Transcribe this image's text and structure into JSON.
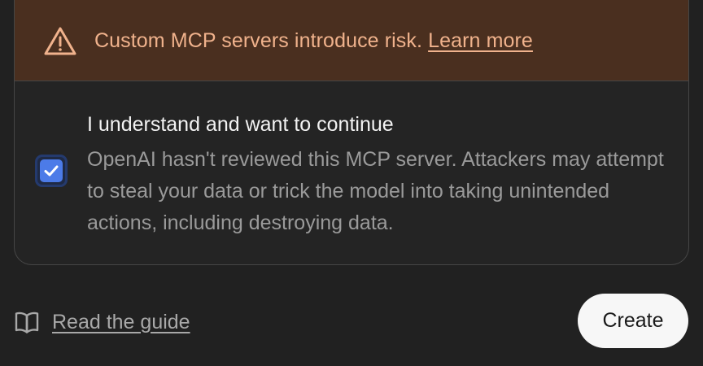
{
  "warning": {
    "icon": "warning-triangle-icon",
    "message": "Custom MCP servers introduce risk. ",
    "link_label": "Learn more",
    "color": "#f0b28c",
    "background": "#4a2f1f"
  },
  "consent": {
    "checked": true,
    "checkbox_icon": "checkmark-icon",
    "accent_color": "#4c7be8",
    "title": "I understand and want to continue",
    "description": "OpenAI hasn't reviewed this MCP server. Attackers may attempt to steal your data or trick the model into taking unintended actions, including destroying data."
  },
  "footer": {
    "guide_icon": "book-icon",
    "guide_label": "Read the guide",
    "create_label": "Create"
  }
}
